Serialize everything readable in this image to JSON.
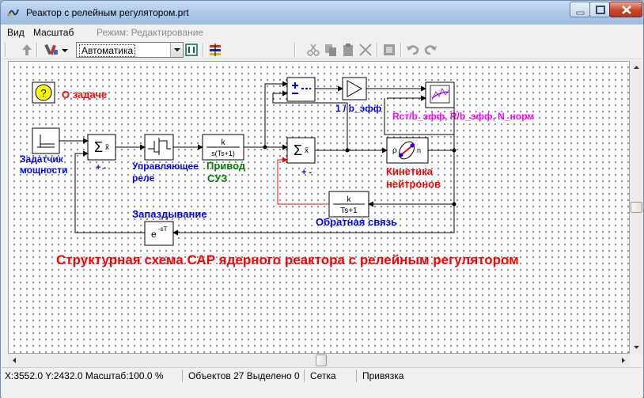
{
  "window": {
    "title": "Реактор с релейным регулятором.prt"
  },
  "menu": {
    "view": "Вид",
    "scale": "Масштаб",
    "mode": "Режим: Редактирование"
  },
  "toolbar": {
    "mode_select_value": "Автоматика"
  },
  "diagram": {
    "about_label": "О задаче",
    "about_icon_text": "?",
    "caption": "Структурная схема САР ядерного реактора с релейным регулятором",
    "blocks": {
      "setpoint": [
        "Задатчик",
        "мощности"
      ],
      "sum1_signs": "+ -",
      "relay": [
        "Управляющее",
        "реле"
      ],
      "drive": [
        "Привод",
        "СУЗ"
      ],
      "drive_tf_num": "k",
      "drive_tf_den": "s(Ts+1)",
      "sum2_signs": "+ -",
      "gain_label": "1 / b_эфф",
      "kinetics": [
        "Кинетика",
        "нейтронов"
      ],
      "kinetics_p": "ρ",
      "kinetics_n": "n",
      "plot_label": "Rст/b_эфф, R/b_эфф, N_норм",
      "feedback_tf_num": "k",
      "feedback_tf_den": "Ts+1",
      "feedback_label": "Обратная связь",
      "delay_label": "Запаздывание",
      "delay_expr": "e",
      "delay_exp": "-sT"
    }
  },
  "status": {
    "coords": "X:3552.0  Y:2432.0  Масштаб:100.0 %",
    "objects": "Объектов 27  Выделено 0",
    "grid": "Сетка",
    "snap": "Привязка"
  },
  "colors": {
    "label_blue": "#0000ff",
    "label_red": "#ff0000",
    "label_green": "#008000",
    "label_magenta": "#ff00ff",
    "feedback_line": "#ff0000",
    "about_icon": "#ffff00"
  },
  "icons": [
    "app-icon",
    "minimize-icon",
    "maximize-icon",
    "close-icon",
    "up-arrow-icon",
    "tools-icon",
    "dropdown-icon",
    "grid-toggle-icon",
    "layers-icon",
    "cut-icon",
    "copy-icon",
    "paste-icon",
    "delete-icon",
    "properties-icon",
    "undo-icon",
    "redo-icon"
  ]
}
